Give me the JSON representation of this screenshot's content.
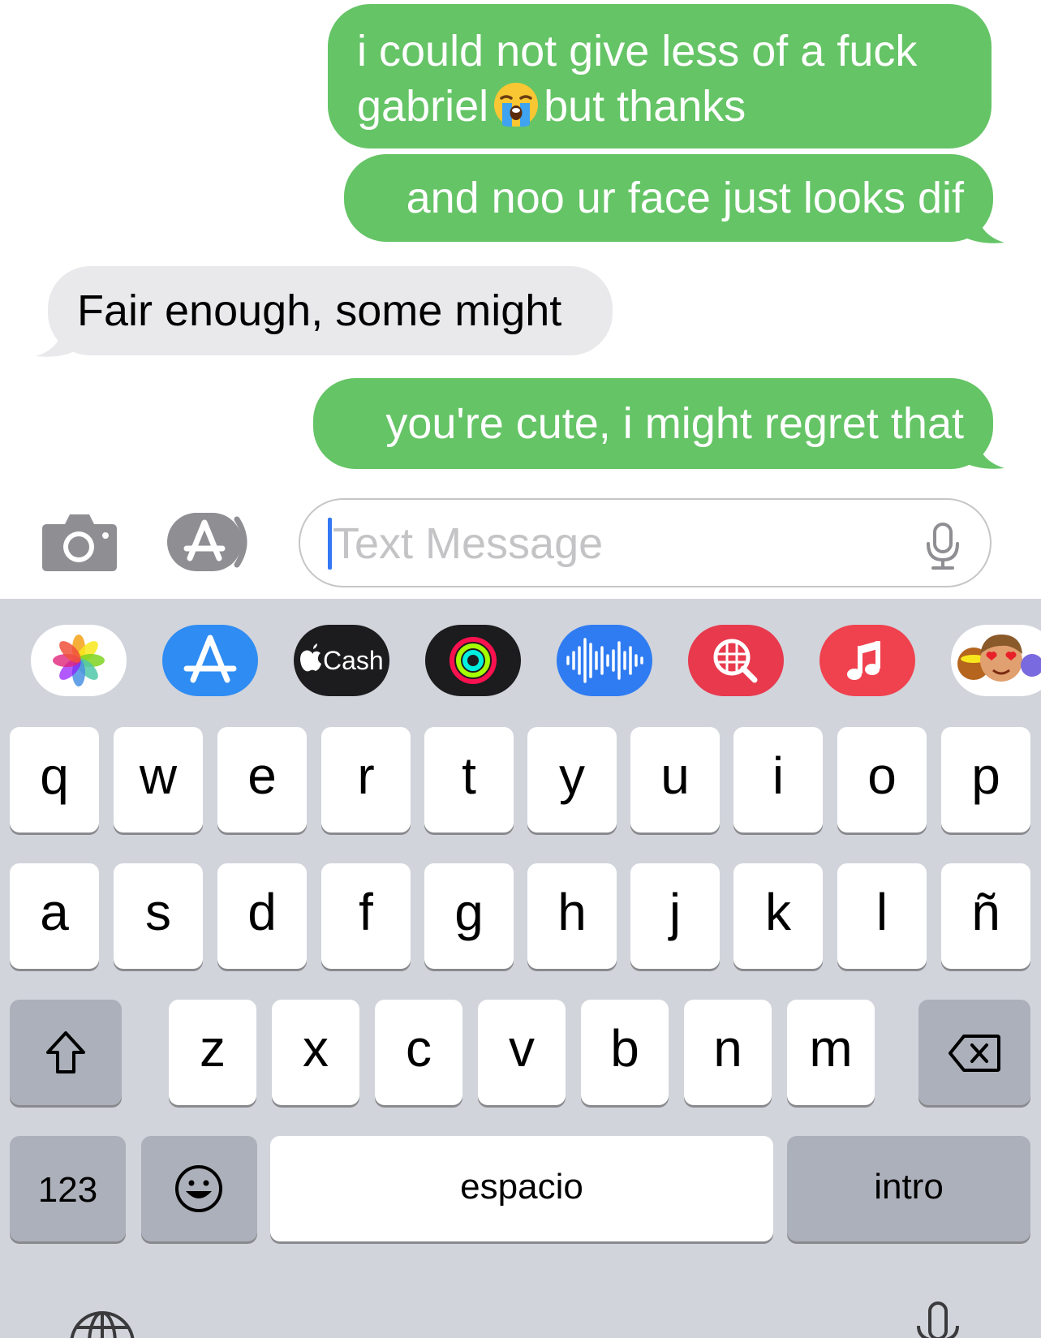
{
  "messages": [
    {
      "direction": "outgoing",
      "line1": "i could not give less of a fuck",
      "line2a": "gabriel",
      "line2b": "but thanks",
      "emoji": "loudly-crying-face"
    },
    {
      "direction": "outgoing",
      "text": "and noo ur face just looks dif"
    },
    {
      "direction": "incoming",
      "text": "Fair enough, some might"
    },
    {
      "direction": "outgoing",
      "text": "you're cute, i might regret that"
    }
  ],
  "input": {
    "placeholder": "Text Message"
  },
  "apps_row": [
    {
      "name": "photos",
      "icon": "photos-icon"
    },
    {
      "name": "app-store",
      "icon": "app-store-icon"
    },
    {
      "name": "cash",
      "label": "Cash"
    },
    {
      "name": "activity",
      "icon": "activity-rings-icon"
    },
    {
      "name": "audio",
      "icon": "waveform-icon"
    },
    {
      "name": "search-images",
      "icon": "globe-search-icon"
    },
    {
      "name": "music",
      "icon": "music-note-icon"
    },
    {
      "name": "memoji",
      "icon": "memoji-icon"
    }
  ],
  "keyboard": {
    "row1": [
      "q",
      "w",
      "e",
      "r",
      "t",
      "y",
      "u",
      "i",
      "o",
      "p"
    ],
    "row2": [
      "a",
      "s",
      "d",
      "f",
      "g",
      "h",
      "j",
      "k",
      "l",
      "ñ"
    ],
    "row3": [
      "z",
      "x",
      "c",
      "v",
      "b",
      "n",
      "m"
    ],
    "numbers_label": "123",
    "space_label": "espacio",
    "return_label": "intro"
  },
  "colors": {
    "outgoing_bubble": "#65c466",
    "incoming_bubble": "#e9e9eb",
    "keyboard_bg": "#d1d4db",
    "caret": "#3478f6"
  }
}
